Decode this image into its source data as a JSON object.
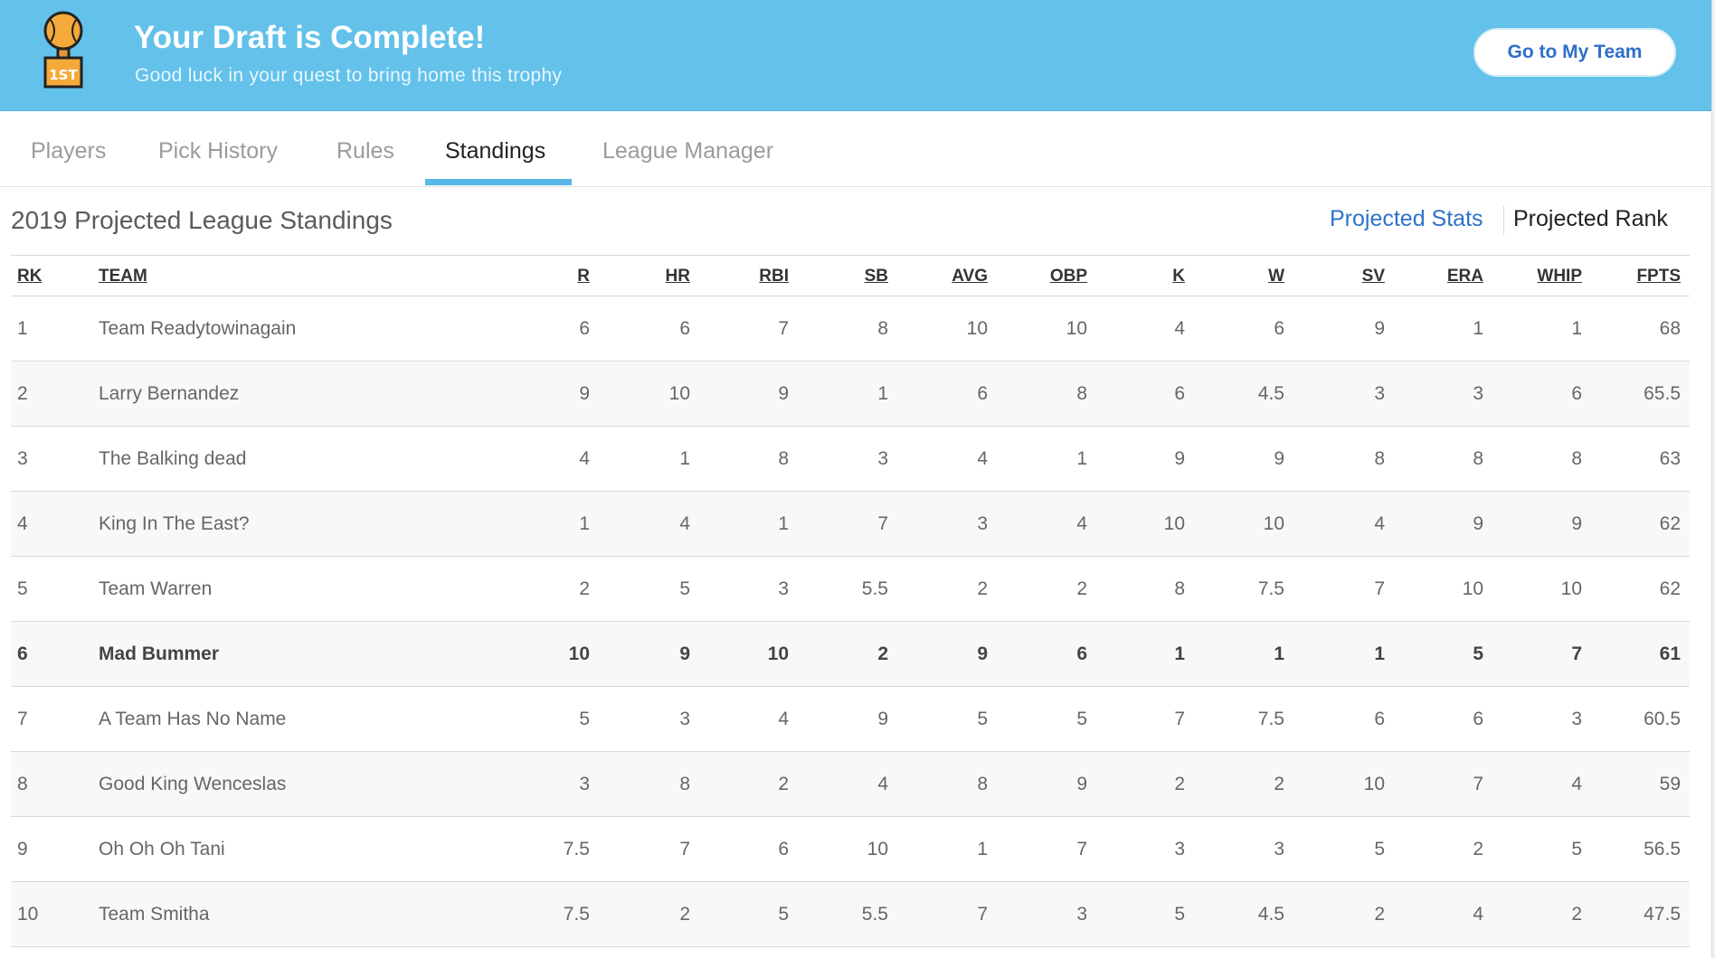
{
  "banner": {
    "title": "Your Draft is Complete!",
    "subtitle": "Good luck in your quest to bring home this trophy",
    "button_label": "Go to My Team",
    "trophy_badge": "1ST",
    "color": "#63c1ea"
  },
  "tabs": [
    {
      "label": "Players",
      "active": false
    },
    {
      "label": "Pick History",
      "active": false
    },
    {
      "label": "Rules",
      "active": false
    },
    {
      "label": "Standings",
      "active": true
    },
    {
      "label": "League Manager",
      "active": false
    }
  ],
  "section": {
    "title": "2019 Projected League Standings",
    "toggle_stats": "Projected Stats",
    "toggle_rank": "Projected Rank",
    "active_toggle": "Projected Rank"
  },
  "table": {
    "headers": [
      "RK",
      "TEAM",
      "R",
      "HR",
      "RBI",
      "SB",
      "AVG",
      "OBP",
      "K",
      "W",
      "SV",
      "ERA",
      "WHIP",
      "FPTS"
    ],
    "rows": [
      [
        "1",
        "Team Readytowinagain",
        "6",
        "6",
        "7",
        "8",
        "10",
        "10",
        "4",
        "6",
        "9",
        "1",
        "1",
        "68"
      ],
      [
        "2",
        "Larry Bernandez",
        "9",
        "10",
        "9",
        "1",
        "6",
        "8",
        "6",
        "4.5",
        "3",
        "3",
        "6",
        "65.5"
      ],
      [
        "3",
        "The Balking dead",
        "4",
        "1",
        "8",
        "3",
        "4",
        "1",
        "9",
        "9",
        "8",
        "8",
        "8",
        "63"
      ],
      [
        "4",
        "King In The East?",
        "1",
        "4",
        "1",
        "7",
        "3",
        "4",
        "10",
        "10",
        "4",
        "9",
        "9",
        "62"
      ],
      [
        "5",
        "Team Warren",
        "2",
        "5",
        "3",
        "5.5",
        "2",
        "2",
        "8",
        "7.5",
        "7",
        "10",
        "10",
        "62"
      ],
      [
        "6",
        "Mad Bummer",
        "10",
        "9",
        "10",
        "2",
        "9",
        "6",
        "1",
        "1",
        "1",
        "5",
        "7",
        "61"
      ],
      [
        "7",
        "A Team Has No Name",
        "5",
        "3",
        "4",
        "9",
        "5",
        "5",
        "7",
        "7.5",
        "6",
        "6",
        "3",
        "60.5"
      ],
      [
        "8",
        "Good King Wenceslas",
        "3",
        "8",
        "2",
        "4",
        "8",
        "9",
        "2",
        "2",
        "10",
        "7",
        "4",
        "59"
      ],
      [
        "9",
        "Oh Oh Oh Tani",
        "7.5",
        "7",
        "6",
        "10",
        "1",
        "7",
        "3",
        "3",
        "5",
        "2",
        "5",
        "56.5"
      ],
      [
        "10",
        "Team Smitha",
        "7.5",
        "2",
        "5",
        "5.5",
        "7",
        "3",
        "5",
        "4.5",
        "2",
        "4",
        "2",
        "47.5"
      ]
    ],
    "highlighted_row": "Mad Bummer"
  }
}
